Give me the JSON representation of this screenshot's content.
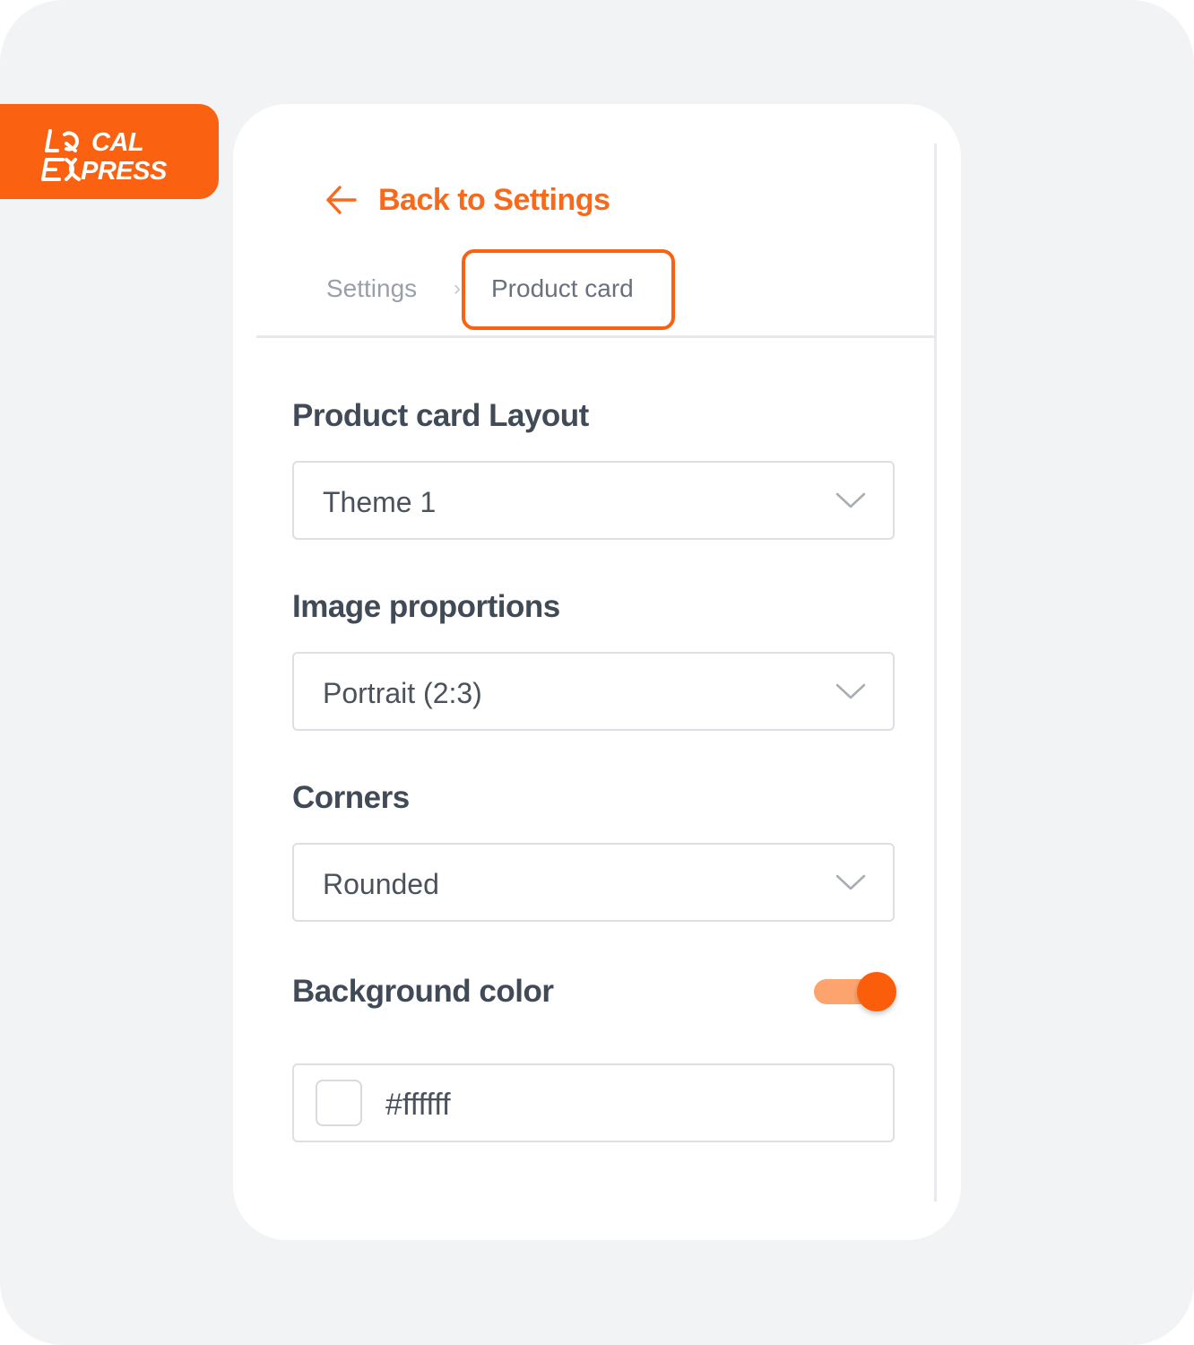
{
  "brand": {
    "line1": "LOCAL",
    "line2": "EXPRESS",
    "color": "#fa6110"
  },
  "header": {
    "back_label": "Back to Settings",
    "back_icon": "arrow-left-icon",
    "accent_color": "#f76a1c"
  },
  "breadcrumb": {
    "items": [
      "Settings",
      "Product card"
    ],
    "separator": "›"
  },
  "fields": {
    "layout": {
      "label": "Product card Layout",
      "value": "Theme 1"
    },
    "proportions": {
      "label": "Image proportions",
      "value": "Portrait (2:3)"
    },
    "corners": {
      "label": "Corners",
      "value": "Rounded"
    },
    "background": {
      "label": "Background color",
      "toggle_on": true,
      "hex": "#ffffff"
    }
  }
}
